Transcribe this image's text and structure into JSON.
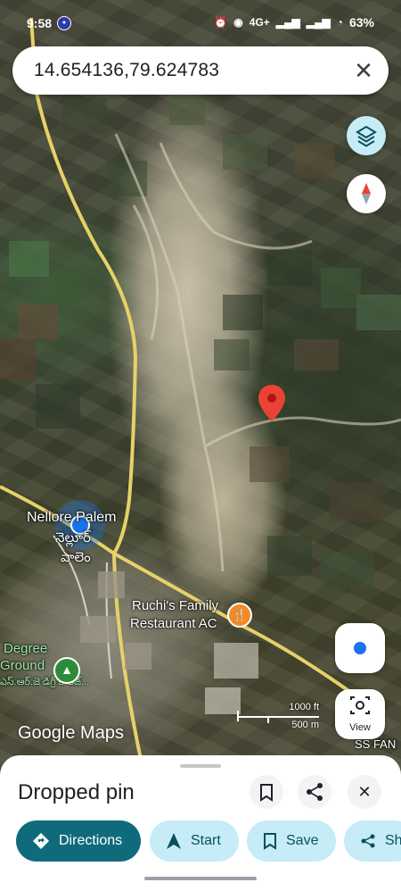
{
  "status_bar": {
    "time": "9:58",
    "network": "4G+",
    "battery": "63%"
  },
  "search": {
    "query": "14.654136,79.624783"
  },
  "map": {
    "labels": {
      "village_en": "Nellore Palem",
      "village_te_1": "నెల్లూర్",
      "village_te_2": "పాలెం",
      "restaurant_1": "Ruchi's Family",
      "restaurant_2": "Restaurant AC",
      "ground_1": "Degree",
      "ground_2": "Ground",
      "ground_te": "ఎస్.ఆర్.జె డిగ్రీ కాలేజ్...",
      "ss_label": "SS FAN"
    },
    "scale": {
      "top": "1000 ft",
      "bottom": "500 m"
    },
    "attribution": "Google Maps",
    "view_label": "View"
  },
  "sheet": {
    "title": "Dropped pin",
    "actions": [
      "Directions",
      "Start",
      "Save",
      "Sha"
    ]
  },
  "colors": {
    "accent": "#0f6b7c",
    "chip": "#c5ecf7",
    "pin": "#ea4335",
    "location": "#1a73e8"
  }
}
